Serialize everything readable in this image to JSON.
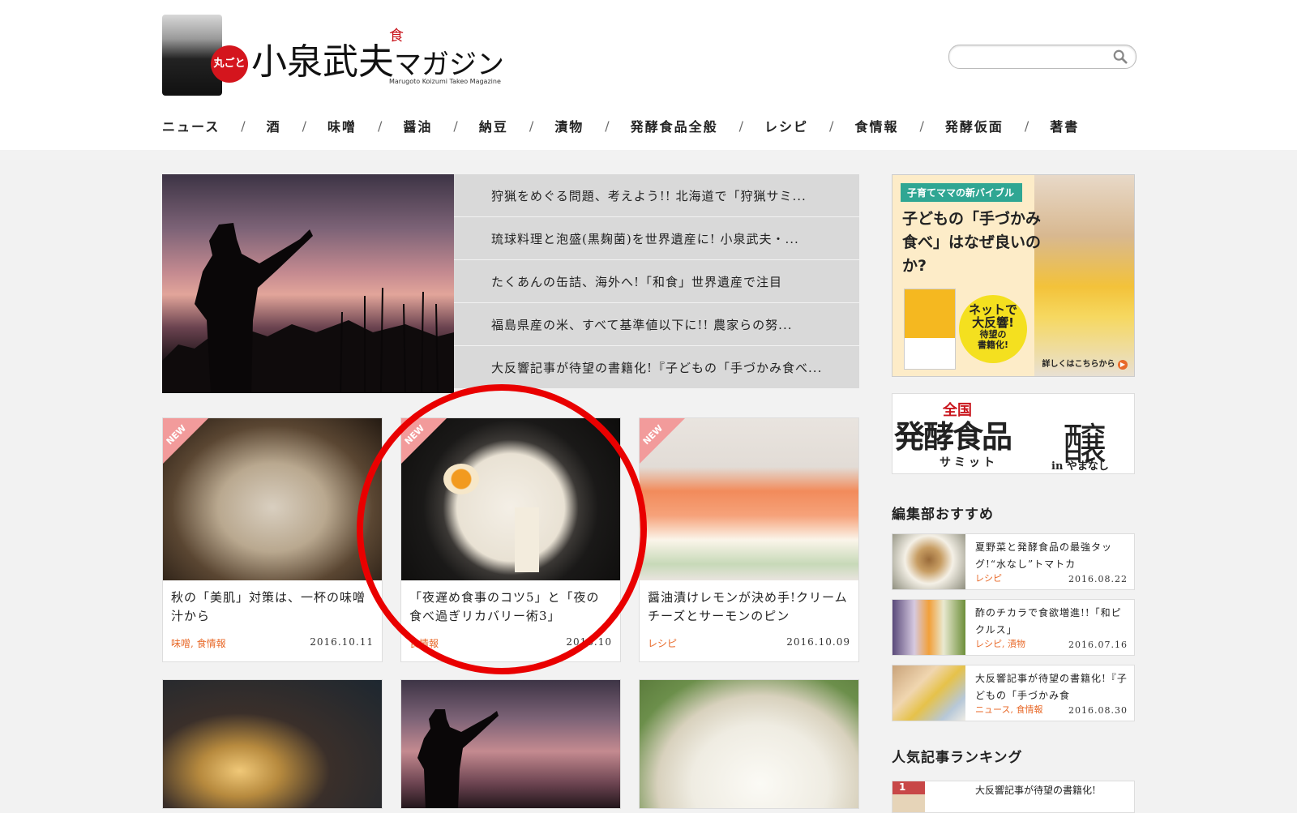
{
  "brand": {
    "badge": "丸ごと",
    "title": "小泉武夫",
    "title_small": "マガジン",
    "kanji": "食",
    "subtitle": "Marugoto Koizumi Takeo Magazine"
  },
  "search": {
    "placeholder": "",
    "icon": "search-icon"
  },
  "nav": [
    "ニュース",
    "酒",
    "味噌",
    "醤油",
    "納豆",
    "漬物",
    "発酵食品全般",
    "レシピ",
    "食情報",
    "発酵仮面",
    "著書"
  ],
  "nav_separator": "/",
  "hero": {
    "items": [
      "狩猟をめぐる問題、考えよう!! 北海道で「狩猟サミ...",
      "琉球料理と泡盛(黒麹菌)を世界遺産に! 小泉武夫・...",
      "たくあんの缶詰、海外へ!「和食」世界遺産で注目",
      "福島県産の米、すべて基準値以下に!! 農家らの努...",
      "大反響記事が待望の書籍化!『子どもの「手づかみ食べ..."
    ]
  },
  "cards": [
    {
      "title": "秋の「美肌」対策は、一杯の味噌汁から",
      "tags": "味噌, 食情報",
      "date": "2016.10.11",
      "badge": "NEW"
    },
    {
      "title": "「夜遅め食事のコツ5」と「夜の食べ過ぎリカバリー術3」",
      "tags": "食情報",
      "date": "2016.10",
      "badge": "NEW"
    },
    {
      "title": "醤油漬けレモンが決め手!クリームチーズとサーモンのピン",
      "tags": "レシピ",
      "date": "2016.10.09",
      "badge": "NEW"
    }
  ],
  "sidebar": {
    "ad1": {
      "tag": "子育てママの新バイブル",
      "headline": "子どもの「手づかみ食べ」はなぜ良いのか?",
      "circle_l1": "ネットで",
      "circle_l2": "大反響!",
      "circle_l3": "待望の",
      "circle_l4": "書籍化!",
      "more": "詳しくはこちらから"
    },
    "ad2": {
      "zenkoku": "全国",
      "main": "発酵食品",
      "summit": "サミット",
      "kanji": "醸",
      "in": "in やまなし"
    },
    "recommend_heading": "編集部おすすめ",
    "recommend": [
      {
        "title": "夏野菜と発酵食品の最強タッグ!“水なし”トマトカ",
        "tags": "レシピ",
        "date": "2016.08.22"
      },
      {
        "title": "酢のチカラで食欲増進!!「和ピクルス」",
        "tags": "レシピ, 漬物",
        "date": "2016.07.16"
      },
      {
        "title": "大反響記事が待望の書籍化!『子どもの「手づかみ食",
        "tags": "ニュース, 食情報",
        "date": "2016.08.30"
      }
    ],
    "ranking_heading": "人気記事ランキング",
    "ranking": [
      {
        "rank": "1",
        "title": "大反響記事が待望の書籍化!"
      }
    ]
  }
}
